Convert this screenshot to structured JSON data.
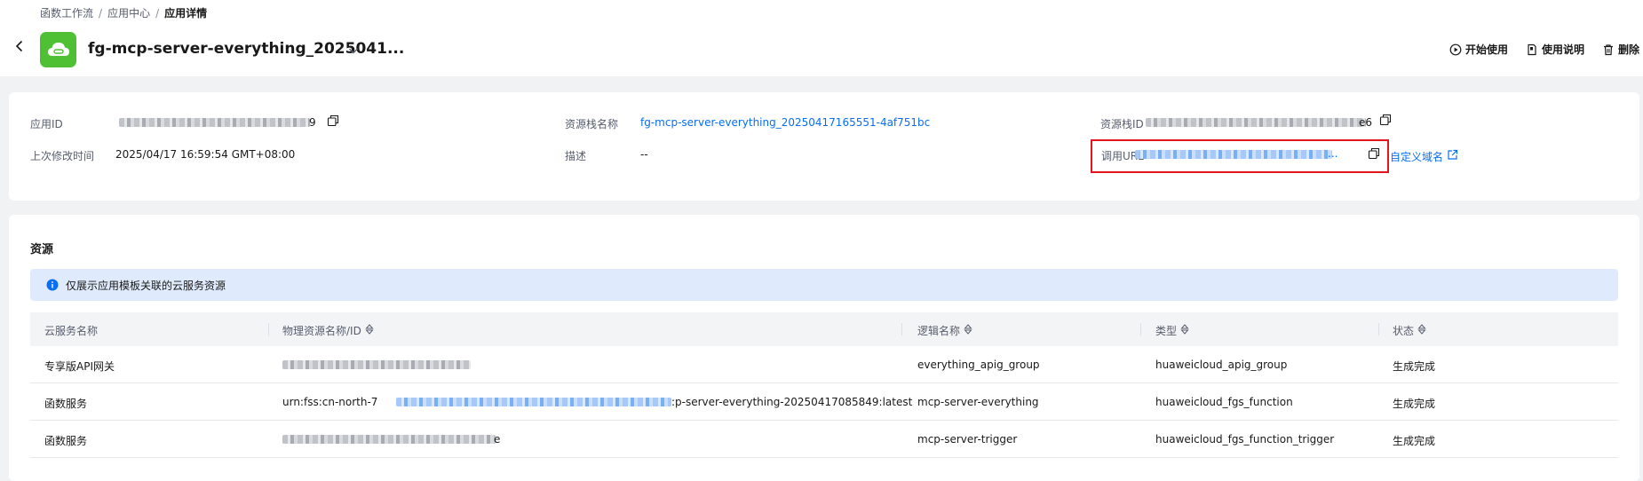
{
  "breadcrumb": {
    "items": [
      "函数工作流",
      "应用中心"
    ],
    "current": "应用详情",
    "separator": "/"
  },
  "header": {
    "app_title": "fg-mcp-server-everything_2025041...",
    "actions": [
      {
        "label": "开始使用",
        "icon": "play-circle-icon"
      },
      {
        "label": "使用说明",
        "icon": "document-icon"
      },
      {
        "label": "删除",
        "icon": "trash-icon"
      }
    ]
  },
  "details": {
    "app_id": {
      "label": "应用ID",
      "visible_suffix": "9"
    },
    "modified": {
      "label": "上次修改时间",
      "value": "2025/04/17 16:59:54 GMT+08:00"
    },
    "stack_name": {
      "label": "资源栈名称",
      "value": "fg-mcp-server-everything_20250417165551-4af751bc"
    },
    "description": {
      "label": "描述",
      "value": "--"
    },
    "stack_id": {
      "label": "资源栈ID",
      "visible_suffix": "e6"
    },
    "invoke_url": {
      "label": "调用URL",
      "visible_suffix": "..."
    },
    "custom_domain": "自定义域名"
  },
  "resources": {
    "title": "资源",
    "notice": "仅展示应用模板关联的云服务资源",
    "columns": [
      "云服务名称",
      "物理资源名称/ID",
      "逻辑名称",
      "类型",
      "状态"
    ],
    "rows": [
      {
        "service": "专享版API网关",
        "physical_suffix": "",
        "logical": "everything_apig_group",
        "type": "huaweicloud_apig_group",
        "status": "生成完成"
      },
      {
        "service": "函数服务",
        "physical_prefix": "urn:fss:cn-north-7",
        "physical_suffix": ":p-server-everything-20250417085849:latest",
        "logical": "mcp-server-everything",
        "type": "huaweicloud_fgs_function",
        "status": "生成完成"
      },
      {
        "service": "函数服务",
        "physical_suffix": "e",
        "logical": "mcp-server-trigger",
        "type": "huaweicloud_fgs_function_trigger",
        "status": "生成完成"
      }
    ]
  },
  "colors": {
    "accent": "#0a6ef1",
    "app_icon": "#4fc034",
    "highlight": "#e4161d",
    "notice_bg": "#dfebfc"
  }
}
